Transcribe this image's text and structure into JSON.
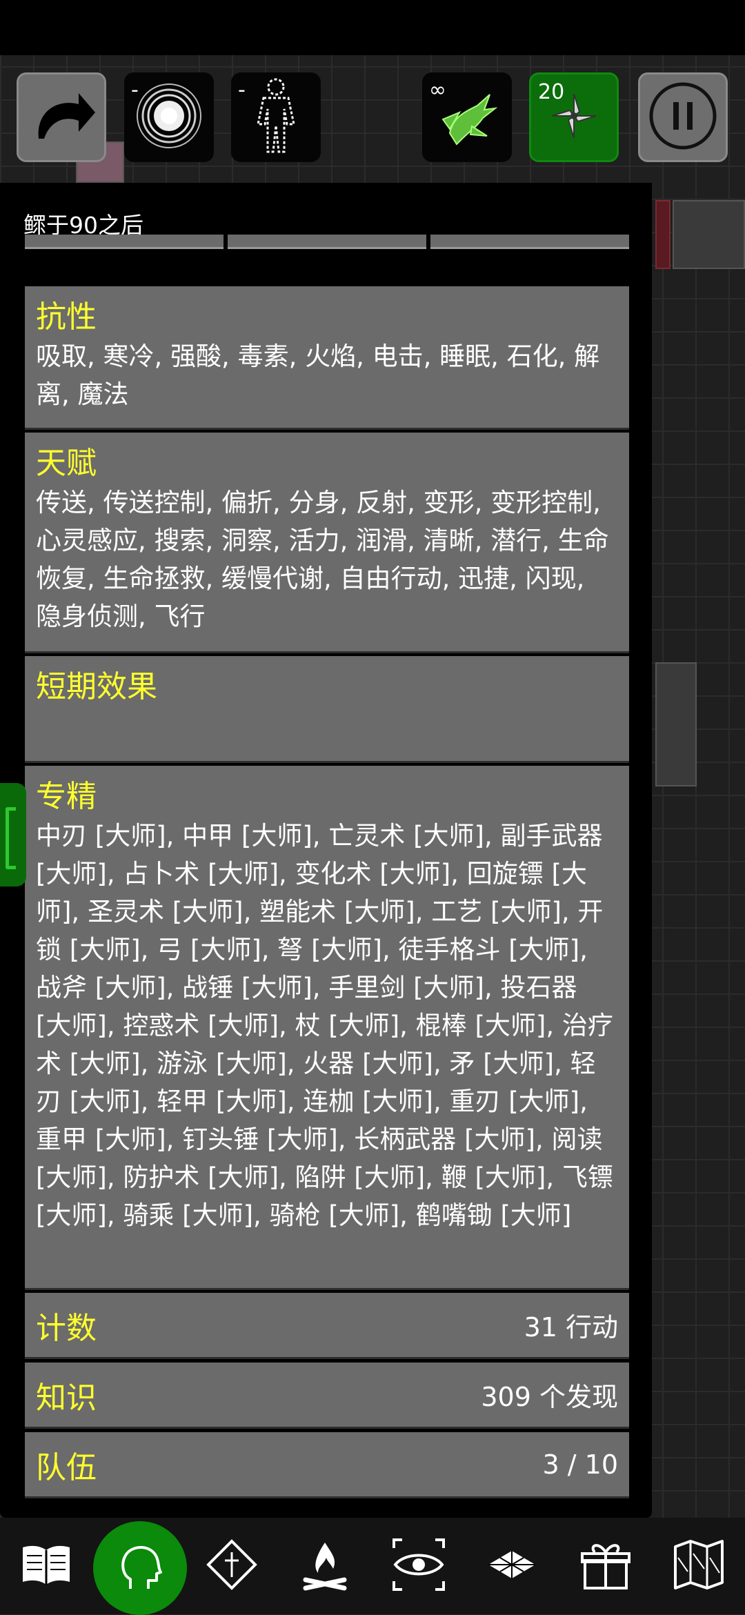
{
  "top_buttons": {
    "spell_count": "-",
    "body_count": "-",
    "ally_count": "∞",
    "shuriken_count": "20"
  },
  "panel": {
    "title": "鳏于90之后",
    "resistances": {
      "heading": "抗性",
      "text": "吸取, 寒冷, 强酸, 毒素, 火焰, 电击, 睡眠, 石化, 解离, 魔法"
    },
    "talents": {
      "heading": "天赋",
      "text": "传送, 传送控制, 偏折, 分身, 反射, 变形, 变形控制, 心灵感应, 搜索, 洞察, 活力, 润滑, 清晰, 潜行, 生命恢复, 生命拯救, 缓慢代谢, 自由行动, 迅捷, 闪现, 隐身侦测, 飞行"
    },
    "short_effects": {
      "heading": "短期效果",
      "text": ""
    },
    "mastery": {
      "heading": "专精",
      "text": "中刃 [大师], 中甲 [大师], 亡灵术 [大师], 副手武器 [大师], 占卜术 [大师], 变化术 [大师], 回旋镖 [大师], 圣灵术 [大师], 塑能术 [大师], 工艺 [大师], 开锁 [大师], 弓 [大师], 弩 [大师], 徒手格斗 [大师], 战斧 [大师], 战锤 [大师], 手里剑 [大师], 投石器 [大师], 控惑术 [大师], 杖 [大师], 棍棒 [大师], 治疗术 [大师], 游泳 [大师], 火器 [大师], 矛 [大师], 轻刃 [大师], 轻甲 [大师], 连枷 [大师], 重刃 [大师], 重甲 [大师], 钉头锤 [大师], 长柄武器 [大师], 阅读 [大师], 防护术 [大师], 陷阱 [大师], 鞭 [大师], 飞镖 [大师], 骑乘 [大师], 骑枪 [大师], 鹤嘴锄 [大师]"
    },
    "count": {
      "label": "计数",
      "value": "31 行动"
    },
    "knowledge": {
      "label": "知识",
      "value": "309 个发现"
    },
    "party": {
      "label": "队伍",
      "value": "3 / 10"
    }
  },
  "bottom_bar": {
    "icons": [
      "book-icon",
      "head-icon",
      "altar-icon",
      "campfire-icon",
      "eye-target-icon",
      "map-layers-icon",
      "gift-icon",
      "map-icon"
    ]
  },
  "colors": {
    "heading": "#ffff2e",
    "section_bg": "#6b6b6b",
    "active_green": "#0b8a0b"
  }
}
